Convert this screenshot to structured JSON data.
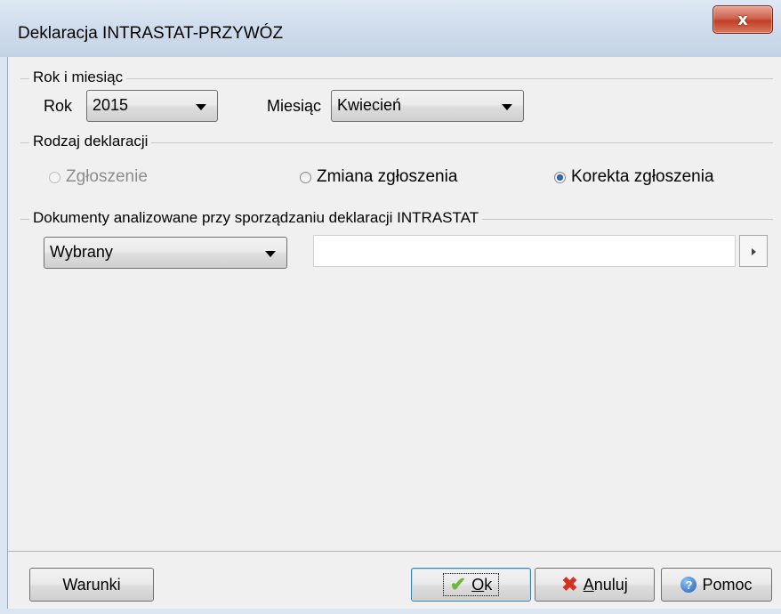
{
  "window": {
    "title": "Deklaracja INTRASTAT-PRZYWÓZ",
    "close_glyph": "x"
  },
  "groups": {
    "period": "Rok i miesiąc",
    "type": "Rodzaj deklaracji",
    "documents": "Dokumenty analizowane przy sporządzaniu deklaracji INTRASTAT"
  },
  "period": {
    "year_label": "Rok",
    "year_value": "2015",
    "month_label": "Miesiąc",
    "month_value": "Kwiecień"
  },
  "declaration_type": {
    "options": [
      {
        "label": "Zgłoszenie",
        "state": "disabled"
      },
      {
        "label": "Zmiana zgłoszenia",
        "state": "unchecked"
      },
      {
        "label": "Korekta zgłoszenia",
        "state": "checked"
      }
    ]
  },
  "documents": {
    "selection": "Wybrany",
    "text_value": ""
  },
  "buttons": {
    "conditions": "Warunki",
    "ok_accel": "O",
    "ok_rest": "k",
    "cancel_accel": "A",
    "cancel_rest": "nuluj",
    "help": "Pomoc"
  },
  "icons": {
    "ok": "check-icon",
    "cancel": "x-icon",
    "help": "help-icon",
    "dropdown": "chevron-down-icon",
    "browse": "triangle-right-icon"
  },
  "colors": {
    "close_button": "#c13f27",
    "ok_check": "#6fb63a",
    "cancel_x": "#d53020",
    "help_blue": "#1f5fb8"
  }
}
